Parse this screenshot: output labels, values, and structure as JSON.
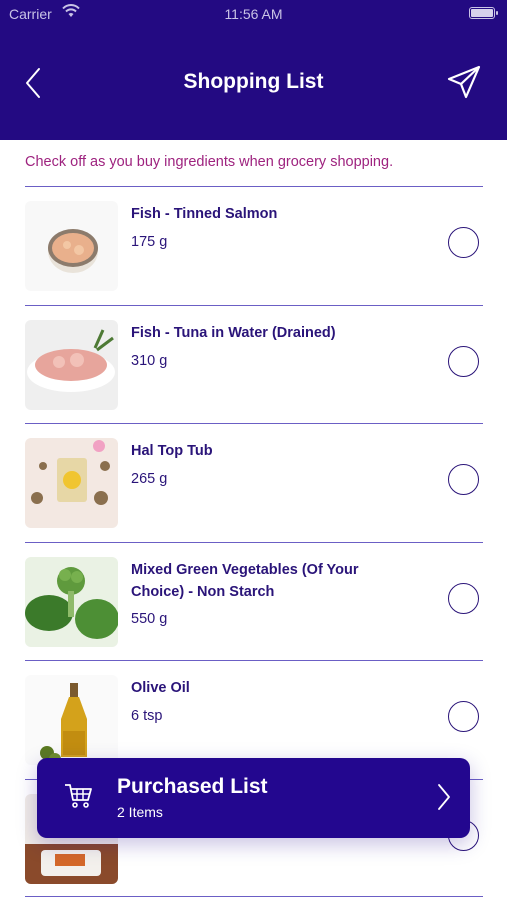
{
  "status_bar": {
    "carrier": "Carrier",
    "time": "11:56 AM"
  },
  "header": {
    "title": "Shopping List"
  },
  "subtitle": "Check off as you buy ingredients when grocery shopping.",
  "items": [
    {
      "name": "Fish - Tinned Salmon",
      "qty": "175 g"
    },
    {
      "name": "Fish - Tuna in Water (Drained)",
      "qty": "310 g"
    },
    {
      "name": "Hal Top Tub",
      "qty": "265 g"
    },
    {
      "name": "Mixed Green Vegetables (Of Your Choice) - Non Starch",
      "qty": "550 g"
    },
    {
      "name": "Olive Oil",
      "qty": "6 tsp"
    },
    {
      "name": "",
      "qty": ""
    }
  ],
  "purchased": {
    "title": "Purchased List",
    "count": "2 Items"
  },
  "colors": {
    "header": "#230a82",
    "accent_text": "#9e237f",
    "item_text": "#2a1479",
    "divider": "#6b5fc5"
  }
}
